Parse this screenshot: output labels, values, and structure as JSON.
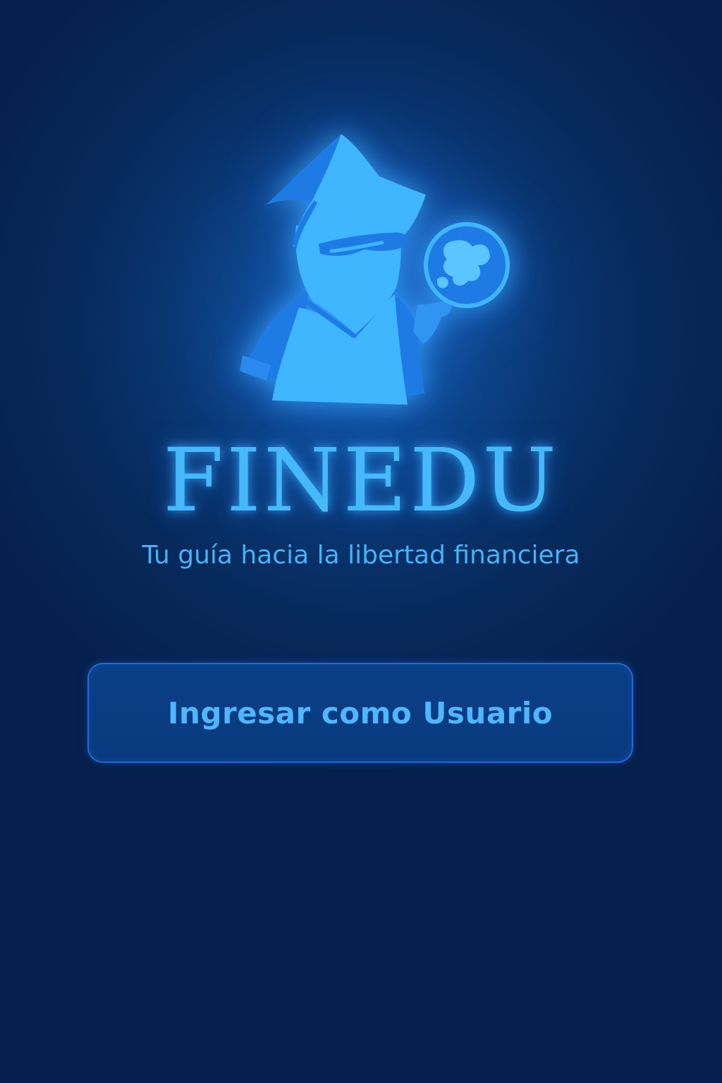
{
  "app": {
    "name": "FINEDU",
    "tagline": "Tu guía hacia la libertad financiera"
  },
  "logo": {
    "icon": "wizard-with-globe-icon"
  },
  "actions": {
    "login_label": "Ingresar como Usuario"
  },
  "colors": {
    "background_dark": "#061f4c",
    "background_center": "#0c4a94",
    "accent": "#45b9fb",
    "mascot_light": "#3fb6ff",
    "mascot_dark": "#1e7be6",
    "button_fill": "#0a3f86",
    "button_border": "#1f6ad6"
  }
}
